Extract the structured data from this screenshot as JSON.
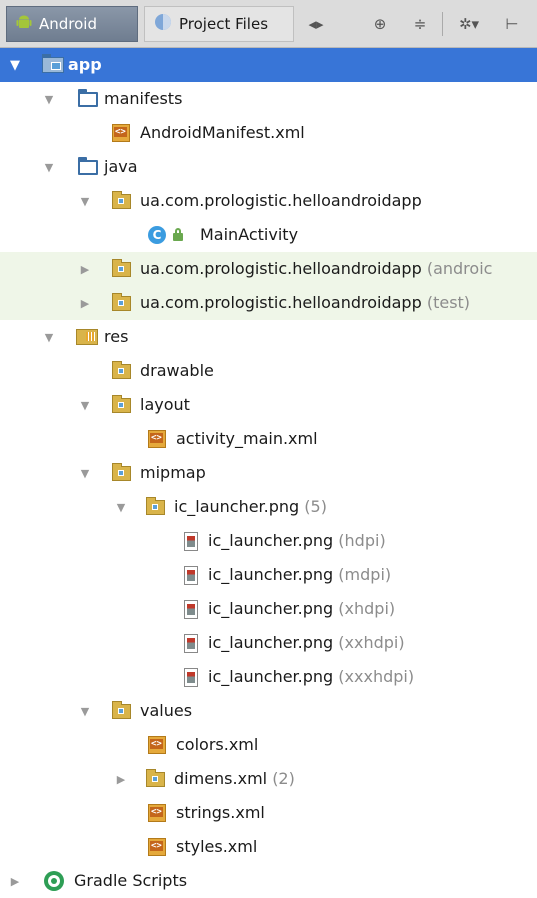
{
  "toolbar": {
    "tabs": [
      {
        "label": "Android",
        "icon": "android-icon",
        "active": true
      },
      {
        "label": "Project Files",
        "icon": "project-files-icon",
        "active": false
      }
    ],
    "buttons": [
      {
        "name": "switch-view-icon",
        "glyph": "◂▸"
      },
      {
        "name": "locate-icon",
        "glyph": "⊕"
      },
      {
        "name": "collapse-all-icon",
        "glyph": "≑"
      },
      {
        "name": "settings-icon",
        "glyph": "✲▾"
      },
      {
        "name": "hide-panel-icon",
        "glyph": "⊢"
      }
    ]
  },
  "tree": {
    "app": {
      "label": "app"
    },
    "manifests": {
      "label": "manifests"
    },
    "android_manifest": {
      "label": "AndroidManifest.xml"
    },
    "java": {
      "label": "java"
    },
    "pkg_main": {
      "label": "ua.com.prologistic.helloandroidapp"
    },
    "main_activity": {
      "label": "MainActivity",
      "class_glyph": "C"
    },
    "pkg_android_test": {
      "label": "ua.com.prologistic.helloandroidapp",
      "extra": "(androic"
    },
    "pkg_test": {
      "label": "ua.com.prologistic.helloandroidapp",
      "extra": "(test)"
    },
    "res": {
      "label": "res"
    },
    "drawable": {
      "label": "drawable"
    },
    "layout": {
      "label": "layout"
    },
    "activity_main": {
      "label": "activity_main.xml"
    },
    "mipmap": {
      "label": "mipmap"
    },
    "ic_launcher_group": {
      "label": "ic_launcher.png",
      "extra": "(5)"
    },
    "ic_hdpi": {
      "label": "ic_launcher.png",
      "extra": "(hdpi)"
    },
    "ic_mdpi": {
      "label": "ic_launcher.png",
      "extra": "(mdpi)"
    },
    "ic_xhdpi": {
      "label": "ic_launcher.png",
      "extra": "(xhdpi)"
    },
    "ic_xxhdpi": {
      "label": "ic_launcher.png",
      "extra": "(xxhdpi)"
    },
    "ic_xxxhdpi": {
      "label": "ic_launcher.png",
      "extra": "(xxxhdpi)"
    },
    "values": {
      "label": "values"
    },
    "colors": {
      "label": "colors.xml"
    },
    "dimens": {
      "label": "dimens.xml",
      "extra": "(2)"
    },
    "strings": {
      "label": "strings.xml"
    },
    "styles": {
      "label": "styles.xml"
    },
    "gradle_scripts": {
      "label": "Gradle Scripts"
    }
  },
  "colors": {
    "selection": "#3875d7",
    "highlight_row": "#eff6e8",
    "secondary_text": "#8c8c8c"
  }
}
